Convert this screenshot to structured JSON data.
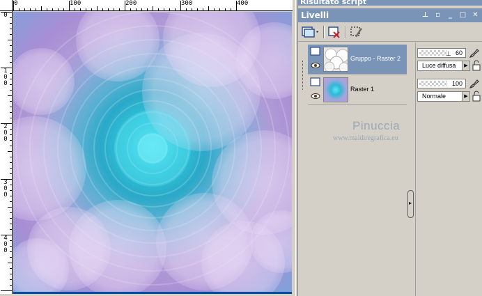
{
  "rulers": {
    "horizontal": [
      "0",
      "100",
      "200",
      "300",
      "400"
    ],
    "vertical": [
      "0",
      "100",
      "200",
      "300",
      "400"
    ]
  },
  "script_panel": {
    "title": "Risultato script"
  },
  "layers_panel": {
    "title": "Livelli",
    "title_buttons": [
      "pin-icon",
      "restore-icon",
      "minimize-icon",
      "maximize-icon",
      "close-icon"
    ],
    "toolbar": {
      "new_layer_icon": "new-layer-icon",
      "delete_icon": "delete-layer-icon",
      "edit_icon": "edit-selection-icon"
    },
    "layers": [
      {
        "name": "Gruppo - Raster 2",
        "selected": true,
        "opacity": "60",
        "blend_mode": "Luce diffusa"
      },
      {
        "name": "Raster 1",
        "selected": false,
        "opacity": "100",
        "blend_mode": "Normale"
      }
    ]
  },
  "watermark": {
    "name": "Pinuccia",
    "url": "www.maidiregrafica.eu"
  },
  "colors": {
    "title_bar": "#7a94b8",
    "panel_bg": "#d4d0c8",
    "selected_row": "#7a94b8"
  }
}
